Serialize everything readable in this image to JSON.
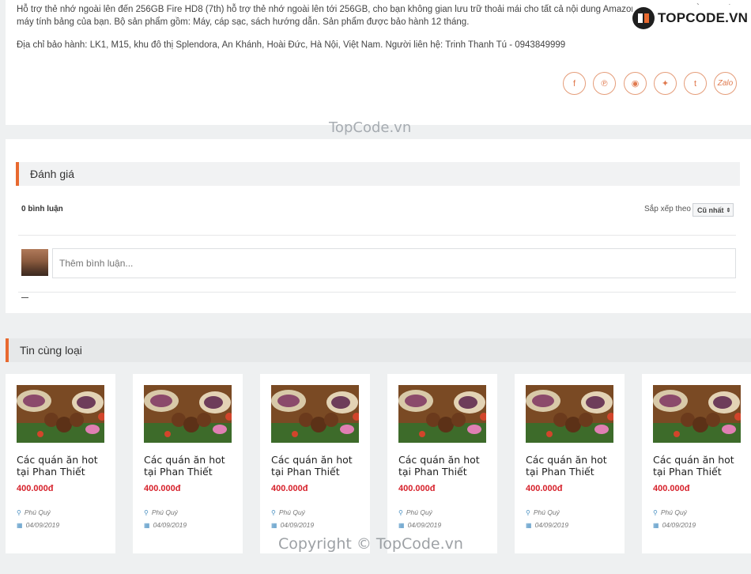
{
  "description": {
    "p1": "Hỗ trợ thẻ nhớ ngoài lên đến 256GB Fire HD8 (7th) hỗ trợ thẻ nhớ ngoài lên tới 256GB, cho bạn không gian lưu trữ thoải mái cho tất cả nội dung Amazon và ảnh chụp bằng chiếc máy tính bảng của bạn. Bộ sản phẩm gồm: Máy, cáp sạc, sách hướng dẫn. Sản phẩm được bảo hành 12 tháng.",
    "p2": "Địa chỉ bảo hành: LK1, M15, khu đô thị Splendora, An Khánh, Hoài Đức, Hà Nội, Việt Nam. Người liên hệ: Trinh Thanh Tú - 0943849999"
  },
  "logo": {
    "text": "TOPCODE.VN"
  },
  "share": {
    "items": [
      {
        "name": "facebook",
        "glyph": "f"
      },
      {
        "name": "pinterest",
        "glyph": "℗"
      },
      {
        "name": "reddit",
        "glyph": "◉"
      },
      {
        "name": "twitter",
        "glyph": "✦"
      },
      {
        "name": "tumblr",
        "glyph": "t"
      },
      {
        "name": "zalo",
        "glyph": "Zalo"
      }
    ]
  },
  "watermarks": {
    "top": "TopCode.vn",
    "bottom": "Copyright © TopCode.vn"
  },
  "reviews": {
    "section_title": "Đánh giá",
    "comment_count": "0 bình luận",
    "sort_label": "Sắp xếp theo",
    "sort_value": "Cũ nhất",
    "input_placeholder": "Thêm bình luận..."
  },
  "related": {
    "section_title": "Tin cùng loại",
    "items": [
      {
        "title": "Các quán ăn hot tại Phan Thiết",
        "price": "400.000đ",
        "location": "Phú Quý",
        "date": "04/09/2019"
      },
      {
        "title": "Các quán ăn hot tại Phan Thiết",
        "price": "400.000đ",
        "location": "Phú Quý",
        "date": "04/09/2019"
      },
      {
        "title": "Các quán ăn hot tại Phan Thiết",
        "price": "400.000đ",
        "location": "Phú Quý",
        "date": "04/09/2019"
      },
      {
        "title": "Các quán ăn hot tại Phan Thiết",
        "price": "400.000đ",
        "location": "Phú Quý",
        "date": "04/09/2019"
      },
      {
        "title": "Các quán ăn hot tại Phan Thiết",
        "price": "400.000đ",
        "location": "Phú Quý",
        "date": "04/09/2019"
      },
      {
        "title": "Các quán ăn hot tại Phan Thiết",
        "price": "400.000đ",
        "location": "Phú Quý",
        "date": "04/09/2019"
      }
    ]
  },
  "colors": {
    "accent": "#e8692f",
    "price": "#d6202a",
    "icon_blue": "#4a90c2"
  }
}
